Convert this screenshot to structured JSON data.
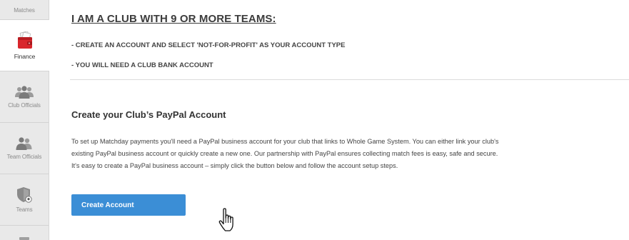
{
  "sidebar": {
    "items": [
      {
        "label": "Matches",
        "icon": "matches-icon",
        "active": false
      },
      {
        "label": "Finance",
        "icon": "wallet-icon",
        "active": true
      },
      {
        "label": "Club Officials",
        "icon": "people-group-icon",
        "active": false
      },
      {
        "label": "Team Officials",
        "icon": "people-pair-icon",
        "active": false
      },
      {
        "label": "Teams",
        "icon": "shield-ball-icon",
        "active": false
      }
    ]
  },
  "main": {
    "heading": "I AM A CLUB WITH 9 OR MORE TEAMS:",
    "bullets": [
      "- CREATE AN ACCOUNT AND SELECT 'NOT-FOR-PROFIT' AS YOUR ACCOUNT TYPE",
      "- YOU WILL NEED A CLUB BANK ACCOUNT"
    ],
    "section_title": "Create your Club’s PayPal Account",
    "description_lines": [
      "To set up Matchday payments you'll need a PayPal business account for your club that links to Whole Game System. You can either link your club's",
      "existing PayPal business account or quickly create a new one. Our partnership with PayPal ensures collecting match fees is easy, safe and secure.",
      "It's easy to create a PayPal business account – simply click the button below and follow the account setup steps."
    ],
    "cta_label": "Create Account"
  },
  "colors": {
    "primary_button": "#3b8ed6",
    "sidebar_bg": "#e9e9e9",
    "finance_icon_red": "#d9262c"
  }
}
